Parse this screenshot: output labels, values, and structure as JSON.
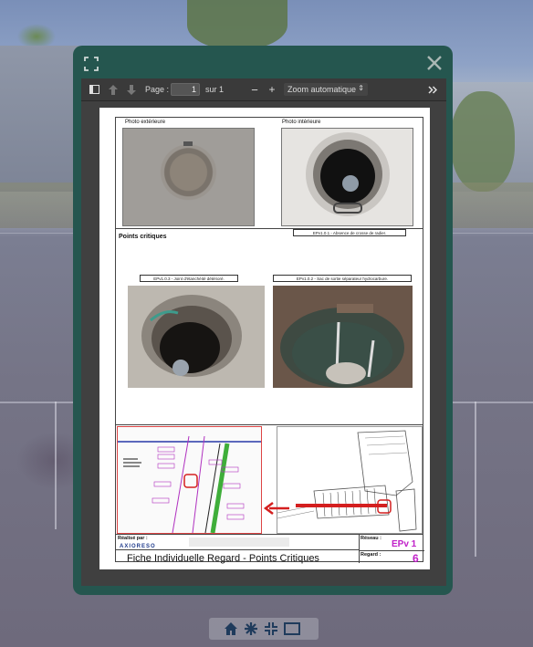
{
  "toolbar": {
    "page_label": "Page :",
    "page_value": "1",
    "page_total": "sur 1",
    "zoom_minus": "−",
    "zoom_plus": "+",
    "zoom_option": "Zoom automatique",
    "zoom_arrow": "⇕"
  },
  "document": {
    "photo_exterior_label": "Photo extérieure",
    "photo_interior_label": "Photo intérieure",
    "critical_points_title": "Points critiques",
    "label_ep1": "EPv1.0.1 - Absence de crosse de radier.",
    "label_ep3": "EPv1.0.3 - Joint d'étanchéité détérioré.",
    "label_ep2": "EPv1.0.2 - Sac de sortie séparateur hydrocarbure.",
    "realised_by_label": "Réalisé par :",
    "company": "AXIORESO",
    "reseau_label": "Réseau :",
    "reseau_value": "EPv 1",
    "regard_label": "Regard :",
    "regard_value": "6",
    "sheet_title": "Fiche Individuelle Regard - Points Critiques"
  },
  "colors": {
    "modal": "#25564f",
    "accent_magenta": "#c020c8",
    "company_blue": "#1f3b8c",
    "arrow_red": "#d41f1f"
  }
}
